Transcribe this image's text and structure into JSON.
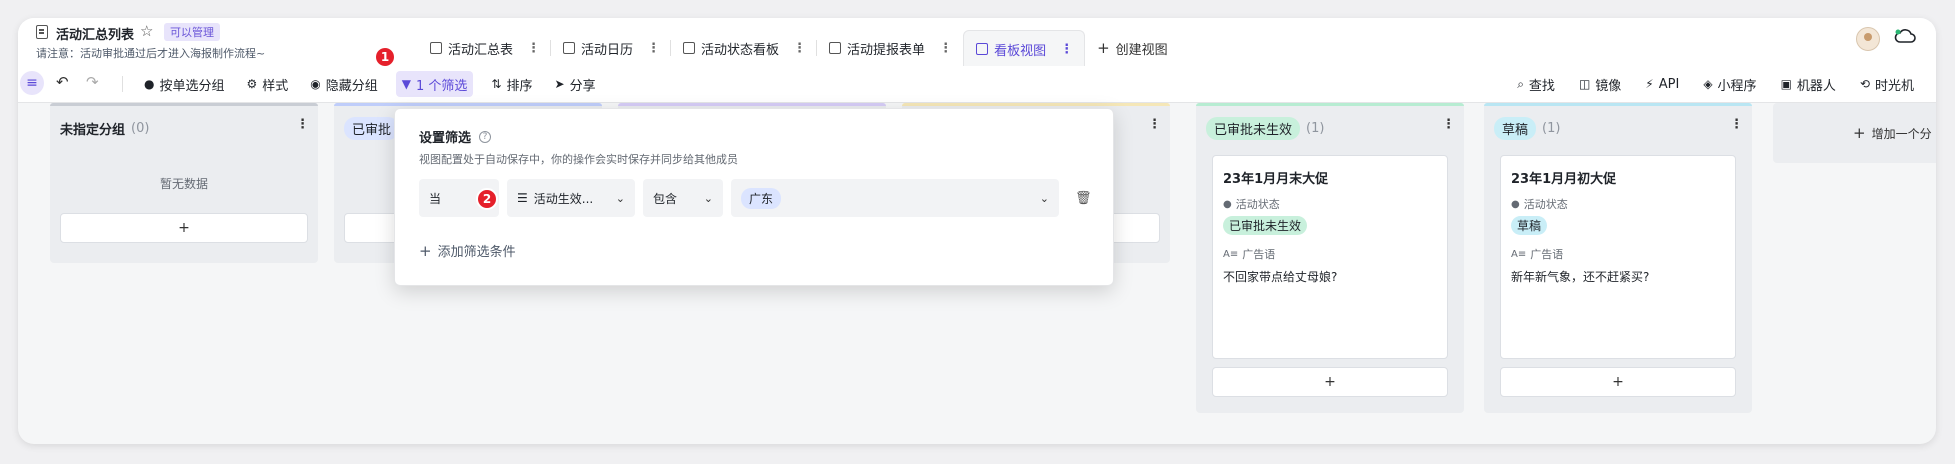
{
  "header": {
    "title": "活动汇总列表",
    "badge": "可以管理",
    "notice": "请注意：活动审批通过后才进入海报制作流程~"
  },
  "tabs": [
    {
      "label": "活动汇总表",
      "icon": "table-icon"
    },
    {
      "label": "活动日历",
      "icon": "calendar-icon"
    },
    {
      "label": "活动状态看板",
      "icon": "kanban-icon"
    },
    {
      "label": "活动提报表单",
      "icon": "form-icon"
    },
    {
      "label": "看板视图",
      "icon": "kanban-icon",
      "active": true
    }
  ],
  "create_view": "创建视图",
  "toolbar": {
    "group_by": "按单选分组",
    "style": "样式",
    "hide_group": "隐藏分组",
    "filter": "1 个筛选",
    "sort": "排序",
    "share": "分享",
    "find": "查找",
    "mirror": "镜像",
    "api": "API",
    "mini_program": "小程序",
    "robot": "机器人",
    "time_machine": "时光机"
  },
  "columns": [
    {
      "title": "未指定分组",
      "count": "(0)",
      "empty": "暂无数据",
      "accent": "#c9cdd4"
    },
    {
      "title": "已审批",
      "accent": "#bfcdfa",
      "pill_bg": "#dbe4ff"
    },
    {
      "accent": "#d6ccf6"
    },
    {
      "accent": "#f5e7b8"
    },
    {
      "title": "已审批未生效",
      "count": "(1)",
      "accent": "#b7ecd2",
      "pill_bg": "#c8f0dc",
      "card": {
        "title": "23年1月月末大促",
        "status_label": "活动状态",
        "status": "已审批未生效",
        "ad_label": "广告语",
        "ad": "不回家带点给丈母娘?"
      }
    },
    {
      "title": "草稿",
      "count": "(1)",
      "accent": "#b9e6f3",
      "pill_bg": "#c9eef7",
      "card": {
        "title": "23年1月月初大促",
        "status_label": "活动状态",
        "status": "草稿",
        "ad_label": "广告语",
        "ad": "新年新气象，还不赶紧买?"
      }
    }
  ],
  "add_group": "增加一个分",
  "filter_popover": {
    "title": "设置筛选",
    "desc": "视图配置处于自动保存中，你的操作会实时保存并同步给其他成员",
    "when": "当",
    "field": "活动生效...",
    "operator": "包含",
    "value": "广东",
    "add_condition": "添加筛选条件"
  },
  "steps": [
    "1",
    "2"
  ],
  "colors": {
    "accent": "#5b49d8",
    "step": "#e5202b"
  }
}
